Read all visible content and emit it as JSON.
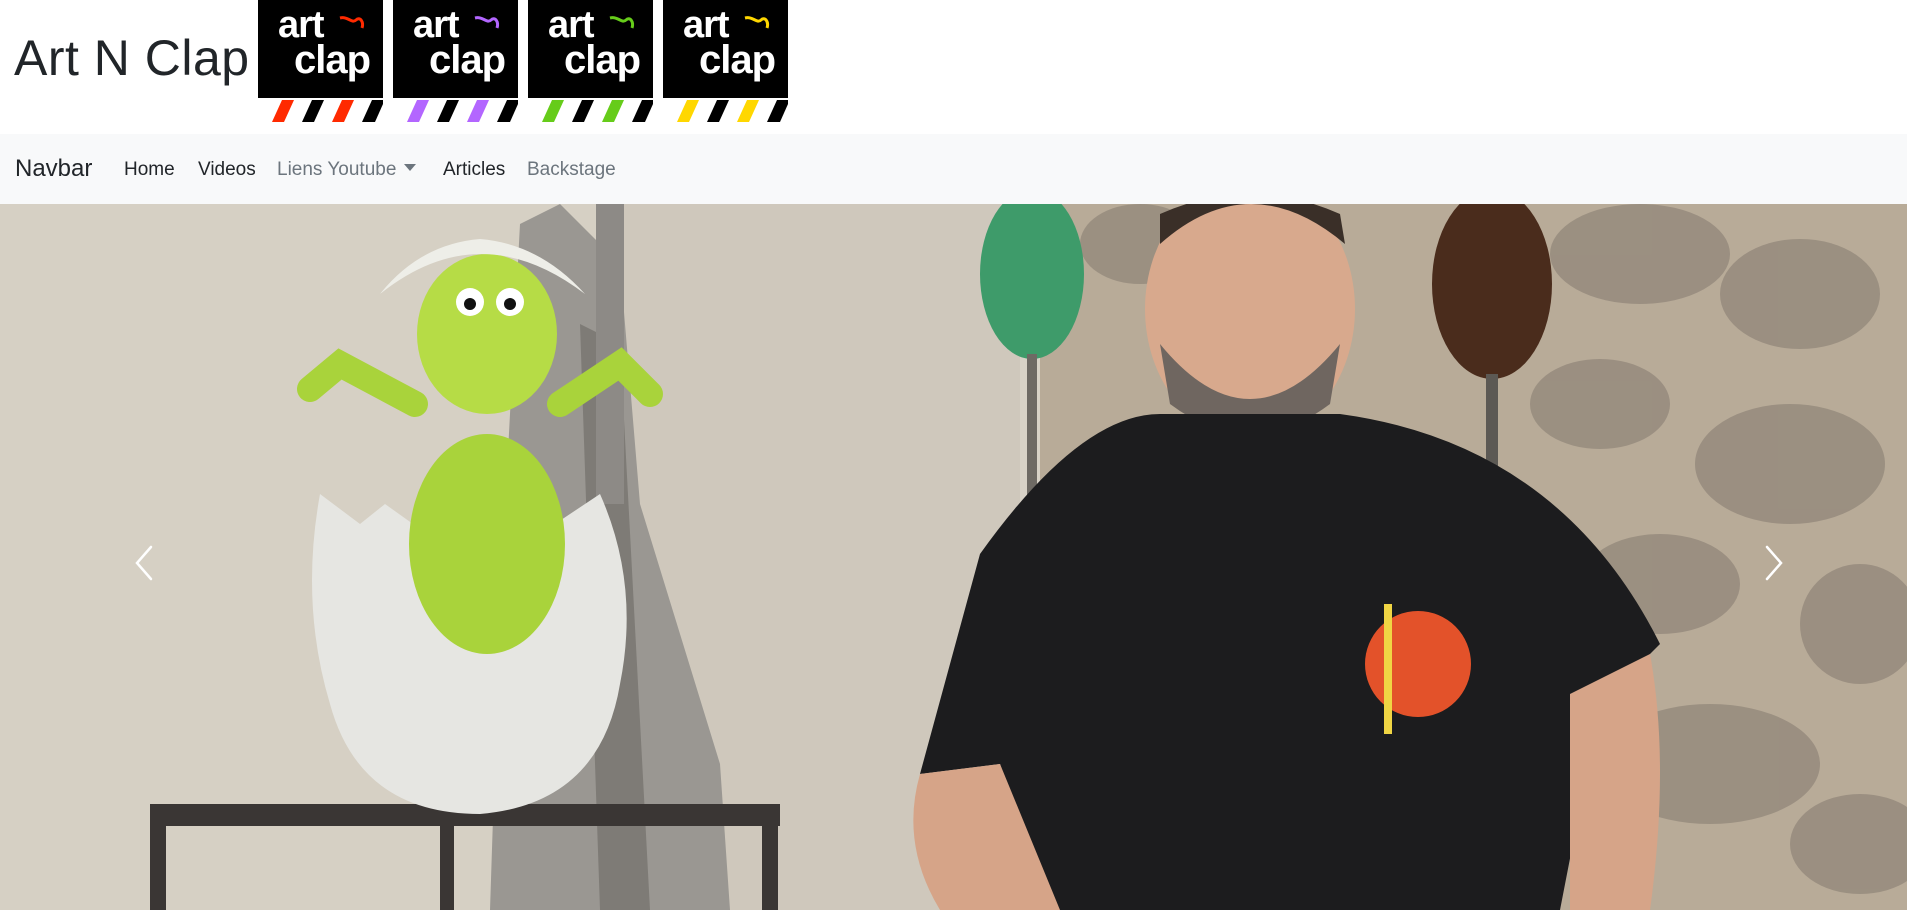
{
  "site": {
    "title": "Art N Clap"
  },
  "logos": [
    {
      "line1": "art",
      "line2": "clap",
      "accent": "#ff2a00",
      "stripe_color": "#ff2a00"
    },
    {
      "line1": "art",
      "line2": "clap",
      "accent": "#b366ff",
      "stripe_color": "#b366ff"
    },
    {
      "line1": "art",
      "line2": "clap",
      "accent": "#66cc1a",
      "stripe_color": "#66cc1a"
    },
    {
      "line1": "art",
      "line2": "clap",
      "accent": "#ffd700",
      "stripe_color": "#ffd700"
    }
  ],
  "navbar": {
    "brand": "Navbar",
    "links": [
      {
        "label": "Home"
      },
      {
        "label": "Videos"
      },
      {
        "label": "Liens Youtube"
      },
      {
        "label": "Articles"
      },
      {
        "label": "Backstage"
      }
    ]
  },
  "carousel": {
    "prev_icon": "chevron-left-icon",
    "next_icon": "chevron-right-icon"
  }
}
